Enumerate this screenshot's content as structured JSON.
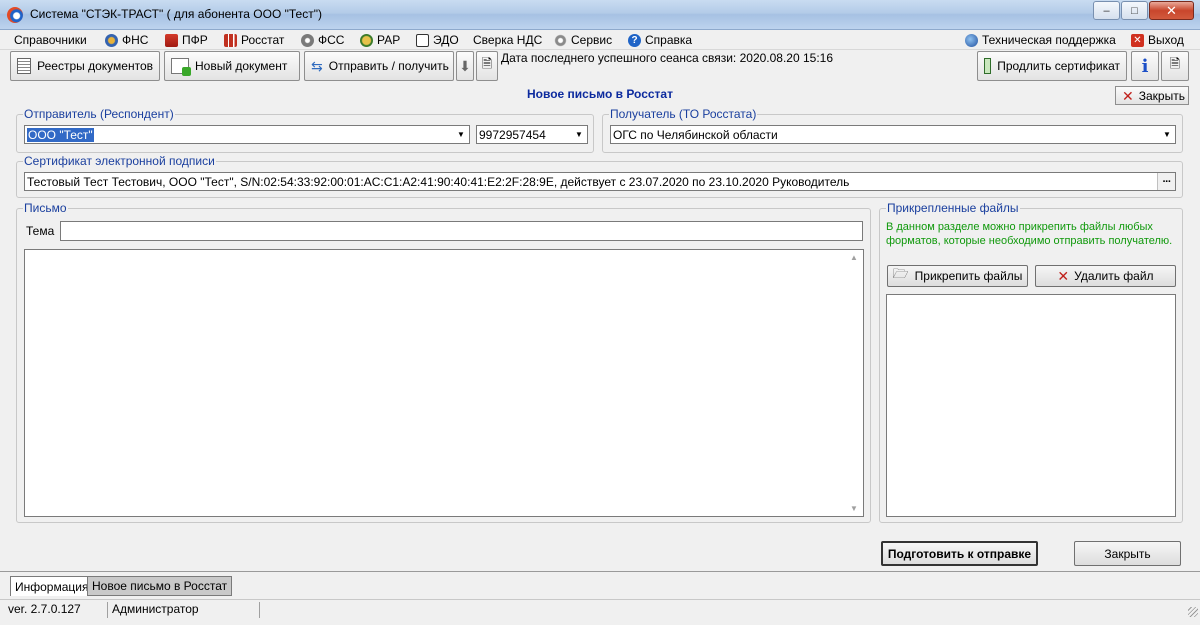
{
  "window": {
    "title": "Система \"СТЭК-ТРАСТ\" ( для абонента ООО \"Тест\")",
    "minimize": "–",
    "maximize": "□",
    "close": "✕"
  },
  "menu": {
    "items": [
      {
        "label": "Справочники",
        "icon": ""
      },
      {
        "label": "ФНС",
        "icon": "fns-icon"
      },
      {
        "label": "ПФР",
        "icon": "pfr-icon"
      },
      {
        "label": "Росстат",
        "icon": "rosstat-icon"
      },
      {
        "label": "ФСС",
        "icon": "fss-icon"
      },
      {
        "label": "РАР",
        "icon": "rar-icon"
      },
      {
        "label": "ЭДО",
        "icon": "edo-icon"
      },
      {
        "label": "Сверка НДС",
        "icon": ""
      },
      {
        "label": "Сервис",
        "icon": "gear-icon"
      },
      {
        "label": "Справка",
        "icon": "help-icon"
      }
    ],
    "support": "Техническая поддержка",
    "exit": "Выход"
  },
  "toolbar": {
    "registries": "Реестры документов",
    "new_document": "Новый документ",
    "send_receive": "Отправить / получить",
    "last_session": "Дата последнего успешного сеанса связи: 2020.08.20 15:16",
    "renew_cert": "Продлить сертификат"
  },
  "form": {
    "title": "Новое письмо в Росстат",
    "close_top": "Закрыть",
    "sender_group": "Отправитель (Респондент)",
    "sender_value": "ООО \"Тест\"",
    "sender_inn": "9972957454",
    "recipient_group": "Получатель (ТО Росстата)",
    "recipient_value": "ОГС по Челябинской области",
    "cert_group": "Сертификат электронной подписи",
    "cert_value": "Тестовый Тест Тестович, ООО \"Тест\", S/N:02:54:33:92:00:01:AC:C1:A2:41:90:40:41:E2:2F:28:9E, действует с 23.07.2020 по 23.10.2020 Руководитель",
    "letter_group": "Письмо",
    "subject_label": "Тема",
    "subject_value": "",
    "body_value": "",
    "files_group": "Прикрепленные файлы",
    "files_hint": "В данном разделе можно прикрепить файлы любых форматов, которые необходимо отправить получателю.",
    "attach_button": "Прикрепить файлы",
    "delete_button": "Удалить файл",
    "prepare_button": "Подготовить к отправке",
    "close_bottom": "Закрыть"
  },
  "tabs": [
    "Информация",
    "Новое письмо в Росстат"
  ],
  "status": {
    "version": "ver. 2.7.0.127",
    "user": "Администратор"
  },
  "colors": {
    "legend": "#1a3f9e",
    "doc_title": "#0c2a9e",
    "hint_green": "#10990c",
    "selection": "#3169c6"
  }
}
